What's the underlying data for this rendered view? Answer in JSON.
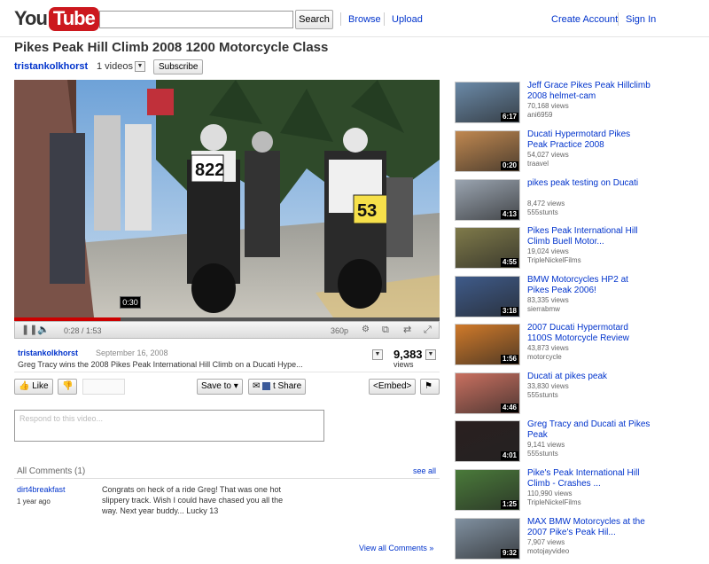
{
  "header": {
    "logo_you": "You",
    "logo_tube": "Tube",
    "search_button": "Search",
    "browse": "Browse",
    "upload": "Upload",
    "create_account": "Create Account",
    "sign_in": "Sign In"
  },
  "video": {
    "title": "Pikes Peak Hill Climb 2008 1200 Motorcycle Class",
    "channel": "tristankolkhorst",
    "videos_count": "1 videos",
    "subscribe": "Subscribe",
    "tooltip_time": "0:30",
    "time": "0:28 / 1:53",
    "quality": "360p",
    "progress": 0.25,
    "bib_822": "822",
    "bib_53": "53"
  },
  "info": {
    "user": "tristankolkhorst",
    "date": "September 16, 2008",
    "description": "Greg Tracy wins the 2008 Pikes Peak International Hill Climb on a Ducati Hype...",
    "views": "9,383",
    "views_label": "views"
  },
  "actions": {
    "like": "Like",
    "save_to": "Save to",
    "share": "Share",
    "embed": "<Embed>"
  },
  "comment_box": {
    "placeholder": "Respond to this video..."
  },
  "comments": {
    "header": "All Comments (1)",
    "see_all": "see all",
    "view_all": "View all Comments »",
    "items": [
      {
        "user": "dirt4breakfast",
        "time": "1 year ago",
        "text": "Congrats on heck of a ride Greg! That was one hot slippery track. Wish I could have chased you all the way. Next year buddy... Lucky 13"
      }
    ]
  },
  "related": [
    {
      "title": "Jeff Grace Pikes Peak Hillclimb 2008 helmet-cam",
      "views": "70,168 views",
      "channel": "ani6959",
      "duration": "6:17",
      "color": "#6b8aa8"
    },
    {
      "title": "Ducati Hypermotard Pikes Peak Practice 2008",
      "views": "54,027 views",
      "channel": "traavel",
      "duration": "0:20",
      "color": "#c08850"
    },
    {
      "title": "pikes peak testing on Ducati",
      "views": "8,472 views",
      "channel": "555stunts",
      "duration": "4:13",
      "color": "#9aa4b0"
    },
    {
      "title": "Pikes Peak International Hill Climb Buell Motor...",
      "views": "19,024 views",
      "channel": "TripleNickelFilms",
      "duration": "4:55",
      "color": "#7f7a4a"
    },
    {
      "title": "BMW Motorcycles HP2 at Pikes Peak 2006!",
      "views": "83,335 views",
      "channel": "sierrabmw",
      "duration": "3:18",
      "color": "#3f5b8a"
    },
    {
      "title": "2007 Ducati Hypermotard 1100S Motorcycle Review",
      "views": "43,873 views",
      "channel": "motorcycle",
      "duration": "1:56",
      "color": "#d07a2a"
    },
    {
      "title": "Ducati at pikes peak",
      "views": "33,830 views",
      "channel": "555stunts",
      "duration": "4:46",
      "color": "#c97060"
    },
    {
      "title": "Greg Tracy and Ducati at Pikes Peak",
      "views": "9,141 views",
      "channel": "555stunts",
      "duration": "4:01",
      "color": "#2a2020"
    },
    {
      "title": "Pike's Peak International Hill Climb - Crashes ...",
      "views": "110,990 views",
      "channel": "TripleNickelFilms",
      "duration": "1:25",
      "color": "#4a7a3a"
    },
    {
      "title": "MAX BMW Motorcycles at the 2007 Pike's Peak Hil...",
      "views": "7,907 views",
      "channel": "motojayvideo",
      "duration": "9:32",
      "color": "#8090a0"
    }
  ]
}
